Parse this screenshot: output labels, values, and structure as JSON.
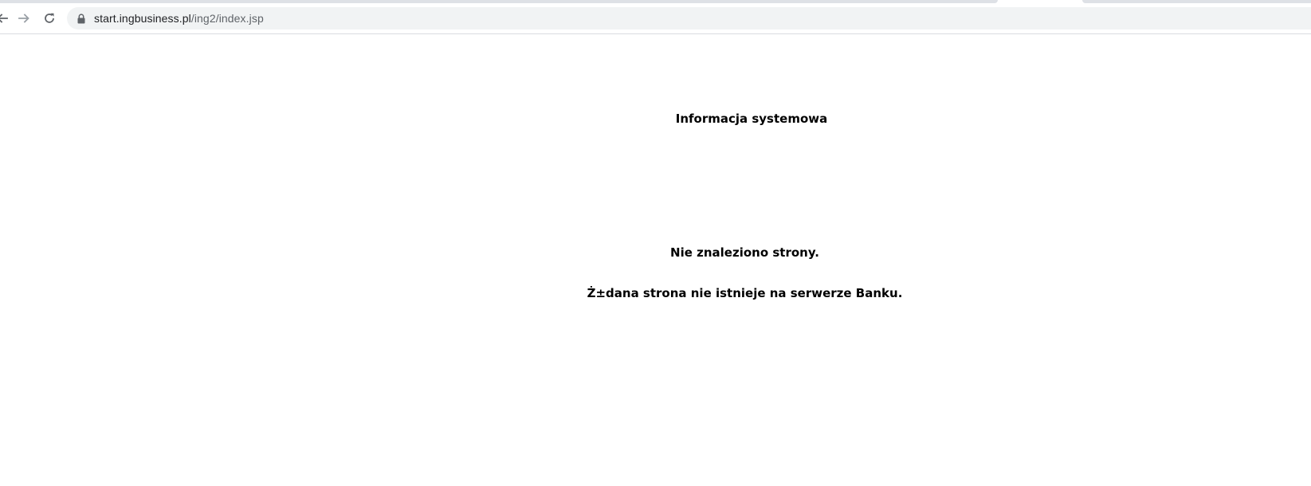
{
  "browser": {
    "url_host": "start.ingbusiness.pl",
    "url_path": "/ing2/index.jsp"
  },
  "icons": {
    "back": "arrow-left-icon",
    "forward": "arrow-right-icon",
    "reload": "reload-icon",
    "secure": "lock-icon"
  },
  "page": {
    "title": "Informacja systemowa",
    "message_primary": "Nie znaleziono strony.",
    "message_secondary": "Ż±dana strona nie istnieje na serwerze Banku."
  }
}
